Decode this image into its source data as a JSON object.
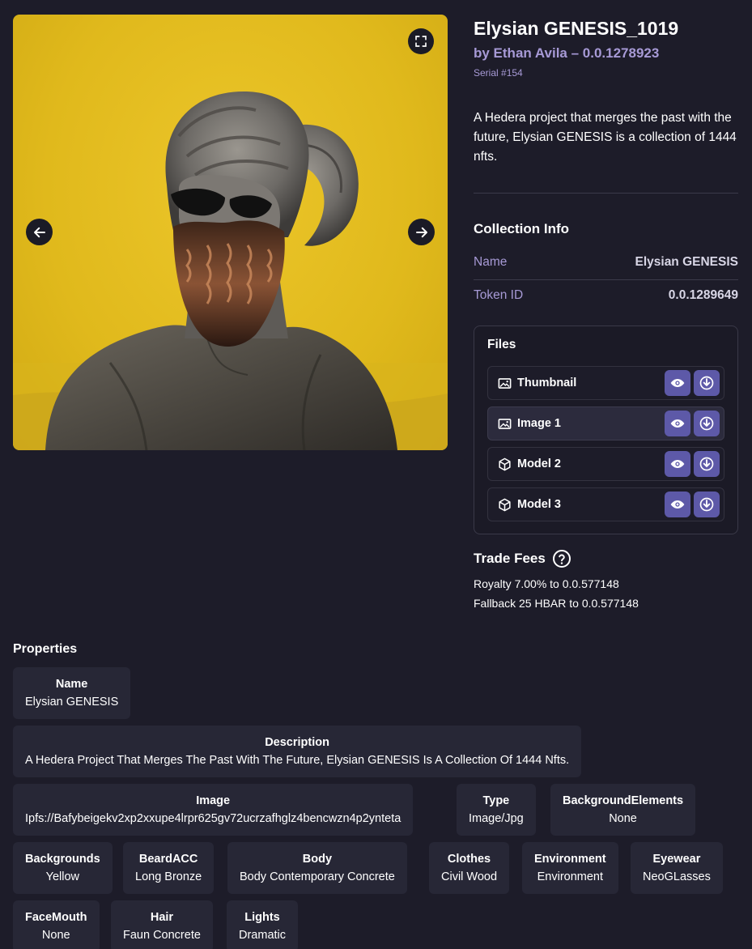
{
  "nft": {
    "title": "Elysian GENESIS_1019",
    "creator": "by Ethan Avila – 0.0.1278923",
    "serial": "Serial #154",
    "description": "A Hedera project that merges the past with the future, Elysian GENESIS is a collection of 1444 nfts."
  },
  "collection_info": {
    "title": "Collection Info",
    "rows": [
      {
        "key": "Name",
        "value": "Elysian GENESIS"
      },
      {
        "key": "Token ID",
        "value": "0.0.1289649"
      }
    ]
  },
  "files": {
    "title": "Files",
    "items": [
      {
        "name": "Thumbnail",
        "icon": "image-icon"
      },
      {
        "name": "Image 1",
        "icon": "image-icon",
        "active": true
      },
      {
        "name": "Model 2",
        "icon": "cube-icon"
      },
      {
        "name": "Model 3",
        "icon": "cube-icon"
      }
    ]
  },
  "trade_fees": {
    "title": "Trade Fees",
    "royalty": "Royalty 7.00% to 0.0.577148",
    "fallback": "Fallback 25 HBAR to 0.0.577148"
  },
  "properties": {
    "title": "Properties",
    "items": [
      {
        "key": "Name",
        "value": "Elysian GENESIS"
      },
      {
        "key": "Description",
        "value": "A Hedera Project That Merges The Past With The Future, Elysian GENESIS Is A Collection Of 1444 Nfts."
      },
      {
        "key": "Image",
        "value": "Ipfs://Bafybeigekv2xp2xxupe4lrpr625gv72ucrzafhglz4bencwzn4p2ynteta"
      },
      {
        "key": "Type",
        "value": "Image/Jpg"
      },
      {
        "key": "BackgroundElements",
        "value": "None"
      },
      {
        "key": "Backgrounds",
        "value": "Yellow"
      },
      {
        "key": "BeardACC",
        "value": "Long Bronze"
      },
      {
        "key": "Body",
        "value": "Body Contemporary Concrete"
      },
      {
        "key": "Clothes",
        "value": "Civil Wood"
      },
      {
        "key": "Environment",
        "value": "Environment"
      },
      {
        "key": "Eyewear",
        "value": "NeoGLasses"
      },
      {
        "key": "FaceMouth",
        "value": "None"
      },
      {
        "key": "Hair",
        "value": "Faun Concrete"
      },
      {
        "key": "Lights",
        "value": "Dramatic"
      }
    ]
  },
  "colors": {
    "background": "#1d1c29",
    "accent": "#5d59a8",
    "muted_text": "#a79ad6",
    "card": "#272736",
    "artwork_background": "#e0b91c"
  }
}
